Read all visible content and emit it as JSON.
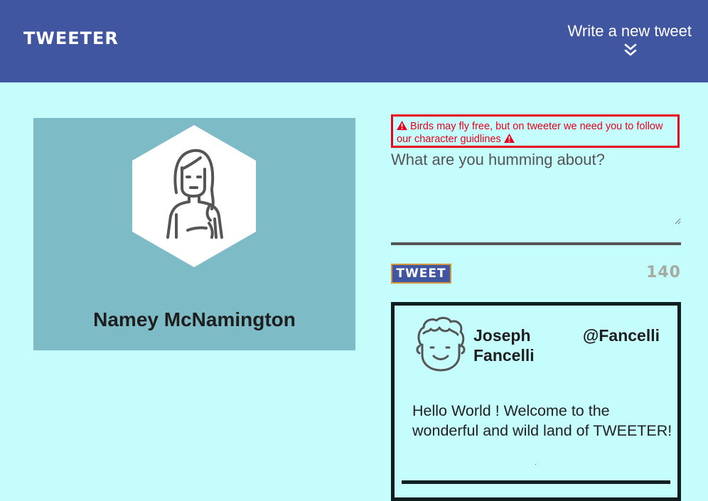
{
  "nav": {
    "brand": "TWEETER",
    "compose_label": "Write a new tweet"
  },
  "profile": {
    "name": "Namey McNamington"
  },
  "compose": {
    "error_message": "Birds may fly free, but on tweeter we need you to follow our character guidlines",
    "placeholder": "What are you humming about?",
    "value": "",
    "tweet_button_label": "TWEET",
    "counter": "140"
  },
  "tweets": [
    {
      "name": "Joseph Fancelli",
      "handle": "@Fancelli",
      "content": "Hello World ! Welcome to the wonderful and wild land of TWEETER!"
    }
  ],
  "colors": {
    "nav_bg": "#4056a1",
    "page_bg": "#c5fcfc",
    "profile_bg": "#7dbcc7",
    "error": "#e8001c",
    "counter": "#a7a9a3",
    "button_border": "#d4943b"
  },
  "icons": [
    "double-chevron-down-icon",
    "warning-icon",
    "user-avatar-icon",
    "tweet-author-avatar-icon"
  ]
}
